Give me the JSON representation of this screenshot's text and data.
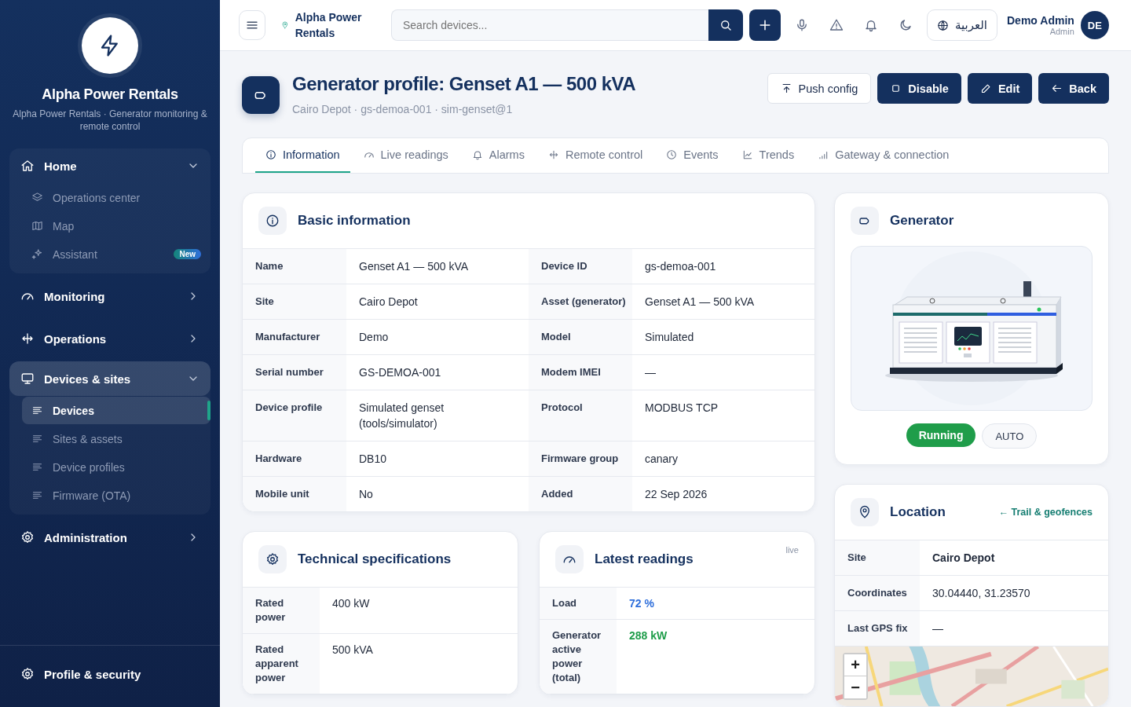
{
  "sidebar": {
    "brand": {
      "name": "Alpha Power Rentals",
      "tagline": "Alpha Power Rentals · Generator monitoring & remote control"
    },
    "nav": [
      {
        "label": "Home",
        "expanded": true,
        "selected": false,
        "children": [
          {
            "label": "Operations center",
            "selected": false
          },
          {
            "label": "Map",
            "selected": false
          },
          {
            "label": "Assistant",
            "selected": false,
            "badge": "New"
          }
        ]
      },
      {
        "label": "Monitoring",
        "expanded": false,
        "selected": false
      },
      {
        "label": "Operations",
        "expanded": false,
        "selected": false
      },
      {
        "label": "Devices & sites",
        "expanded": true,
        "selected": true,
        "children": [
          {
            "label": "Devices",
            "selected": true
          },
          {
            "label": "Sites & assets",
            "selected": false
          },
          {
            "label": "Device profiles",
            "selected": false
          },
          {
            "label": "Firmware (OTA)",
            "selected": false
          }
        ]
      },
      {
        "label": "Administration",
        "expanded": false,
        "selected": false
      }
    ],
    "footer_link": "Profile & security"
  },
  "topbar": {
    "location": "Alpha Power Rentals",
    "search": {
      "placeholder": "Search devices..."
    },
    "language": "العربية",
    "user": {
      "name": "Demo Admin",
      "role": "Admin",
      "initials": "DE"
    }
  },
  "header": {
    "title": "Generator profile: Genset A1 — 500 kVA",
    "subtitle": "Cairo Depot · gs-demoa-001 · sim-genset@1",
    "actions": [
      {
        "label": "Push config",
        "kind": "outline"
      },
      {
        "label": "Disable",
        "kind": "primary"
      },
      {
        "label": "Edit",
        "kind": "primary"
      },
      {
        "label": "Back",
        "kind": "primary"
      }
    ]
  },
  "tabs": [
    {
      "label": "Information",
      "selected": true
    },
    {
      "label": "Live readings",
      "selected": false
    },
    {
      "label": "Alarms",
      "selected": false
    },
    {
      "label": "Remote control",
      "selected": false
    },
    {
      "label": "Events",
      "selected": false
    },
    {
      "label": "Trends",
      "selected": false
    },
    {
      "label": "Gateway & connection",
      "selected": false
    }
  ],
  "basic_info": {
    "title": "Basic information",
    "rows": [
      [
        {
          "label": "Name",
          "value": "Genset A1 — 500 kVA"
        },
        {
          "label": "Device ID",
          "value": "gs-demoa-001"
        }
      ],
      [
        {
          "label": "Site",
          "value": "Cairo Depot"
        },
        {
          "label": "Asset (generator)",
          "value": "Genset A1 — 500 kVA"
        }
      ],
      [
        {
          "label": "Manufacturer",
          "value": "Demo"
        },
        {
          "label": "Model",
          "value": "Simulated"
        }
      ],
      [
        {
          "label": "Serial number",
          "value": "GS-DEMOA-001"
        },
        {
          "label": "Modem IMEI",
          "value": "—"
        }
      ],
      [
        {
          "label": "Device profile",
          "value": "Simulated genset (tools/simulator)"
        },
        {
          "label": "Protocol",
          "value": "MODBUS TCP"
        }
      ],
      [
        {
          "label": "Hardware",
          "value": "DB10"
        },
        {
          "label": "Firmware group",
          "value": "canary"
        }
      ],
      [
        {
          "label": "Mobile unit",
          "value": "No"
        },
        {
          "label": "Added",
          "value": "22 Sep 2026"
        }
      ]
    ]
  },
  "tech_specs": {
    "title": "Technical specifications",
    "rows": [
      {
        "label": "Rated power",
        "value": "400 kW"
      },
      {
        "label": "Rated apparent power",
        "value": "500 kVA"
      }
    ]
  },
  "readings": {
    "title": "Latest readings",
    "badge": "live",
    "rows": [
      {
        "label": "Load",
        "value": "72 %",
        "color": "#2f6fdb"
      },
      {
        "label": "Generator active power (total)",
        "value": "288 kW",
        "color": "#1f9d4a"
      }
    ]
  },
  "generator": {
    "title": "Generator",
    "status": "Running",
    "mode": "AUTO"
  },
  "location": {
    "title": "Location",
    "link": "← Trail & geofences",
    "rows": [
      {
        "label": "Site",
        "value": "Cairo Depot",
        "emphasis": true
      },
      {
        "label": "Coordinates",
        "value": "30.04440, 31.23570",
        "emphasis": false
      },
      {
        "label": "Last GPS fix",
        "value": "—",
        "emphasis": false
      }
    ],
    "map": {
      "kind": "picture",
      "zoom_in": "+",
      "zoom_out": "−"
    }
  }
}
